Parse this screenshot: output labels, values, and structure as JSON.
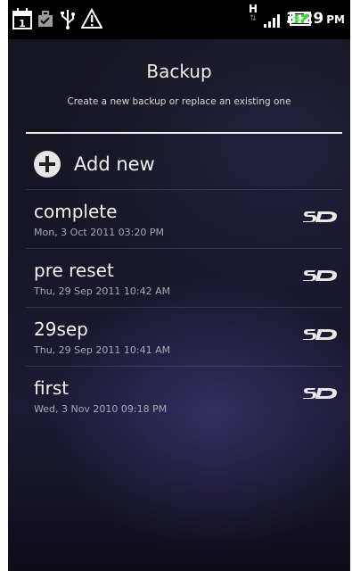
{
  "status": {
    "time": "3:29",
    "ampm": "PM",
    "network": "H",
    "icons": [
      "calendar-icon",
      "briefcase-icon",
      "usb-icon",
      "warning-icon",
      "network-h-icon",
      "signal-icon",
      "battery-icon"
    ],
    "calendar_day": "1"
  },
  "header": {
    "title": "Backup",
    "subtitle": "Create a new backup or replace an existing one"
  },
  "add_new": {
    "label": "Add new",
    "icon": "plus-circle-icon"
  },
  "backups": [
    {
      "name": "complete",
      "date": "Mon, 3 Oct 2011 03:20 PM",
      "storage": "SD"
    },
    {
      "name": "pre reset",
      "date": "Thu, 29 Sep 2011 10:42 AM",
      "storage": "SD"
    },
    {
      "name": "29sep",
      "date": "Thu, 29 Sep 2011 10:41 AM",
      "storage": "SD"
    },
    {
      "name": "first",
      "date": "Wed, 3 Nov 2010 09:18 PM",
      "storage": "SD"
    }
  ],
  "colors": {
    "battery_green": "#3fd83f",
    "divider": "#e9e9e9",
    "background": "#1a1930"
  }
}
